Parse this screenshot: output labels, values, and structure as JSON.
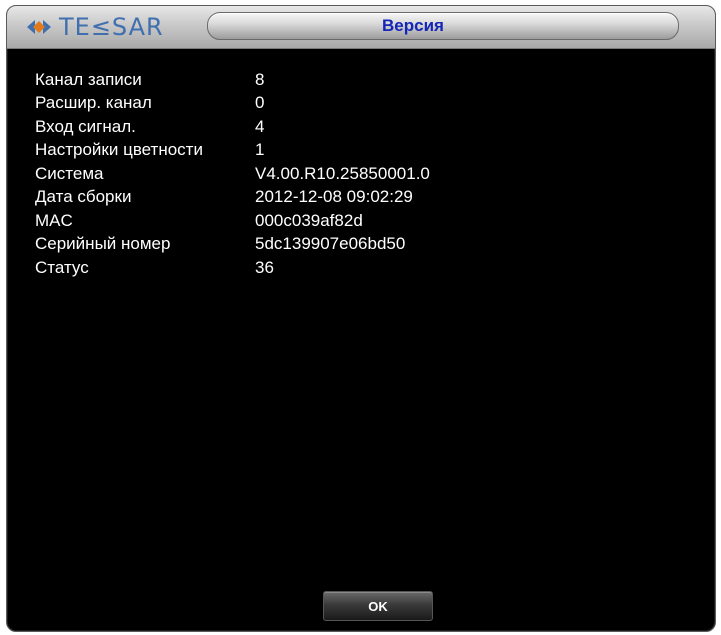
{
  "window": {
    "title": "Версия",
    "logo_text": "TE≤SAR"
  },
  "info_rows": [
    {
      "label": "Канал записи",
      "value": "8"
    },
    {
      "label": "Расшир. канал",
      "value": "0"
    },
    {
      "label": "Вход сигнал.",
      "value": "4"
    },
    {
      "label": "Настройки цветности",
      "value": "1"
    },
    {
      "label": "Система",
      "value": "V4.00.R10.25850001.0"
    },
    {
      "label": "Дата сборки",
      "value": "2012-12-08 09:02:29"
    },
    {
      "label": "MAC",
      "value": "000c039af82d"
    },
    {
      "label": "Серийный номер",
      "value": "5dc139907e06bd50"
    },
    {
      "label": "Статус",
      "value": "36"
    }
  ],
  "buttons": {
    "ok_label": "OK"
  },
  "colors": {
    "background": "#000000",
    "text": "#ffffff",
    "title_text": "#1426b8",
    "logo": "#3f6fae",
    "logo_accent": "#e07a1c"
  }
}
